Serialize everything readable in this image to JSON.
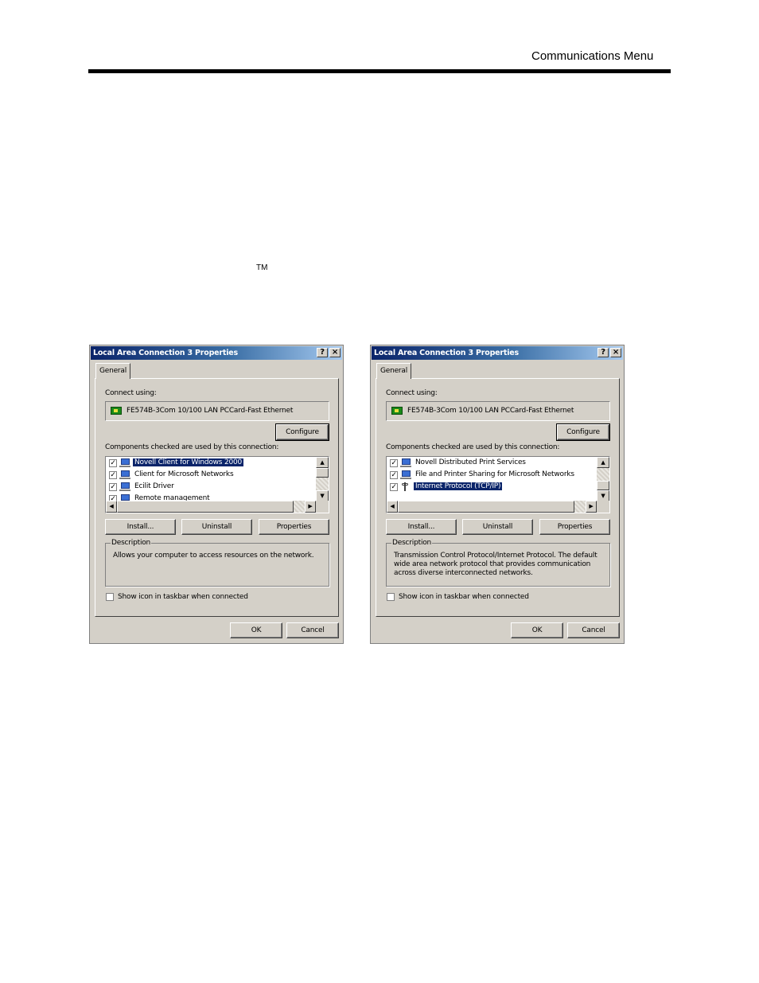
{
  "page": {
    "header": "Communications Menu",
    "trademark": "TM"
  },
  "dialogs": [
    {
      "title": "Local Area Connection 3 Properties",
      "help_glyph": "?",
      "close_glyph": "×",
      "tab": "General",
      "connect_using_label": "Connect using:",
      "adapter": "FE574B-3Com 10/100 LAN PCCard-Fast Ethernet",
      "configure": "Configure",
      "components_label": "Components checked are used by this connection:",
      "components": [
        {
          "label": "Novell Client for Windows 2000",
          "checked": true,
          "icon": "network-client-icon",
          "selected": true
        },
        {
          "label": "Client for Microsoft Networks",
          "checked": true,
          "icon": "network-client-icon",
          "selected": false
        },
        {
          "label": "Ecilit Driver",
          "checked": true,
          "icon": "network-service-icon",
          "selected": false
        },
        {
          "label": "Remote management",
          "checked": true,
          "icon": "network-service-icon",
          "selected": false
        }
      ],
      "install": "Install...",
      "uninstall": "Uninstall",
      "properties": "Properties",
      "description_title": "Description",
      "description": "Allows your computer to access resources on the network.",
      "show_icon_label": "Show icon in taskbar when connected",
      "show_icon_checked": false,
      "ok": "OK",
      "cancel": "Cancel"
    },
    {
      "title": "Local Area Connection 3 Properties",
      "help_glyph": "?",
      "close_glyph": "×",
      "tab": "General",
      "connect_using_label": "Connect using:",
      "adapter": "FE574B-3Com 10/100 LAN PCCard-Fast Ethernet",
      "configure": "Configure",
      "components_label": "Components checked are used by this connection:",
      "components": [
        {
          "label": "Novell Distributed Print Services",
          "checked": true,
          "icon": "network-service-icon",
          "selected": false
        },
        {
          "label": "File and Printer Sharing for Microsoft Networks",
          "checked": true,
          "icon": "network-service-icon",
          "selected": false
        },
        {
          "label": "Internet Protocol (TCP/IP)",
          "checked": true,
          "icon": "protocol-icon",
          "selected": true
        }
      ],
      "install": "Install...",
      "uninstall": "Uninstall",
      "properties": "Properties",
      "description_title": "Description",
      "description": "Transmission Control Protocol/Internet Protocol. The default wide area network protocol that provides communication across diverse interconnected networks.",
      "show_icon_label": "Show icon in taskbar when connected",
      "show_icon_checked": false,
      "ok": "OK",
      "cancel": "Cancel"
    }
  ],
  "colors": {
    "dialog_face": "#d4d0c8",
    "title_active": "#0a246a",
    "selection": "#0a246a"
  }
}
